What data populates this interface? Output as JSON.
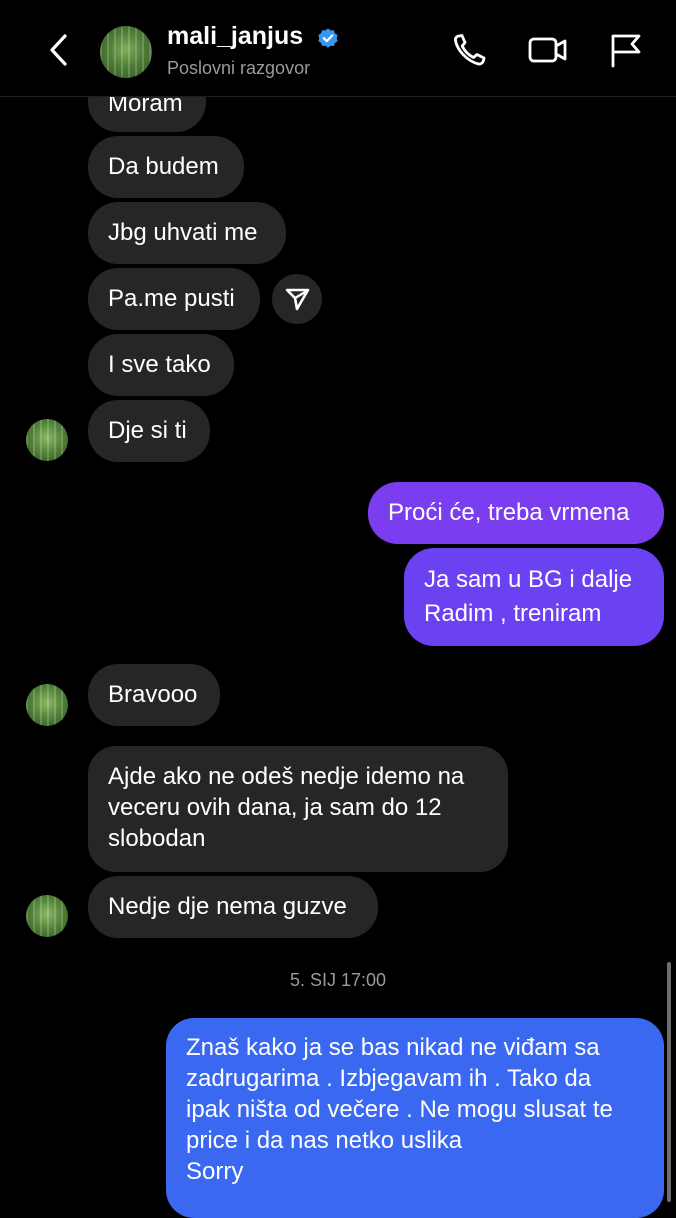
{
  "header": {
    "username": "mali_janjus",
    "subtitle": "Poslovni razgovor",
    "icons": [
      "back-chevron-icon",
      "verified-badge-icon",
      "phone-icon",
      "video-camera-icon",
      "flag-icon"
    ]
  },
  "colors": {
    "incoming": "#262626",
    "outgoing_purple": "#7a3ef0",
    "outgoing_violet": "#6a42f2",
    "outgoing_blue": "#3b68f0",
    "verified": "#3897f0"
  },
  "messages": {
    "m1": "Moram",
    "m2": "Da budem",
    "m3": "Jbg uhvati me",
    "m4": "Pa.me pusti",
    "m5": "I sve tako",
    "m6": "Dje si ti",
    "m7": "Proći će, treba vrmena",
    "m8_line1": "Ja sam u BG i dalje",
    "m8_line2": "Radim , treniram",
    "m9": "Bravooo",
    "m10_line1": "Ajde ako ne odeš nedje idemo na",
    "m10_line2": "veceru ovih dana, ja sam do 12",
    "m10_line3": "slobodan",
    "m11": "Nedje dje nema guzve",
    "m12_line1": "Znaš kako ja se bas nikad ne viđam sa",
    "m12_line2": "zadrugarima . Izbjegavam ih . Tako da",
    "m12_line3": "ipak ništa od večere . Ne mogu slusat te",
    "m12_line4": "price i da nas netko uslika",
    "m12_line5": "Sorry"
  },
  "timestamp": "5. SIJ 17:00"
}
